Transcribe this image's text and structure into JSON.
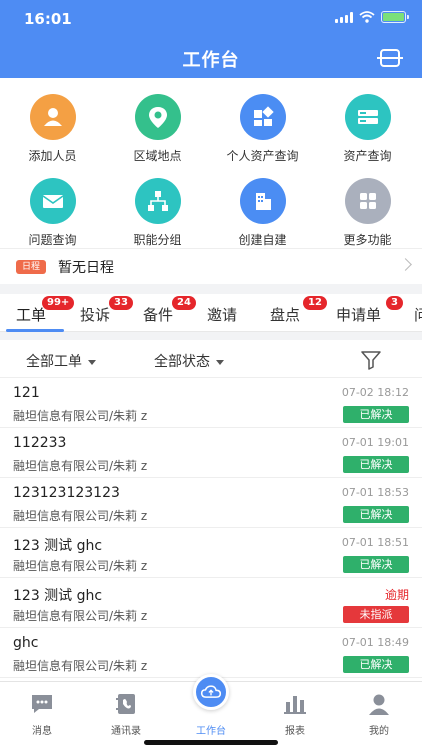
{
  "status_bar": {
    "time": "16:01"
  },
  "header": {
    "title": "工作台"
  },
  "grid": [
    {
      "label": "添加人员",
      "icon": "add-person-icon",
      "color": "#f4a044"
    },
    {
      "label": "区域地点",
      "icon": "location-pin-icon",
      "color": "#34c08c"
    },
    {
      "label": "个人资产查询",
      "icon": "personal-asset-icon",
      "color": "#4b8df3"
    },
    {
      "label": "资产查询",
      "icon": "asset-query-icon",
      "color": "#2dc4c1"
    },
    {
      "label": "问题查询",
      "icon": "problem-mail-icon",
      "color": "#2dc4c1"
    },
    {
      "label": "职能分组",
      "icon": "org-chart-icon",
      "color": "#2dc4c1"
    },
    {
      "label": "创建自建",
      "icon": "building-icon",
      "color": "#4b8df3"
    },
    {
      "label": "更多功能",
      "icon": "more-apps-icon",
      "color": "#aab0bd"
    }
  ],
  "schedule": {
    "badge": "日程",
    "text": "暂无日程"
  },
  "tabs": [
    {
      "label": "工单",
      "badge": "99+"
    },
    {
      "label": "投诉",
      "badge": "33"
    },
    {
      "label": "备件",
      "badge": "24"
    },
    {
      "label": "邀请",
      "badge": ""
    },
    {
      "label": "盘点",
      "badge": "12"
    },
    {
      "label": "申请单",
      "badge": "3"
    },
    {
      "label": "问",
      "badge": ""
    }
  ],
  "filters": {
    "type": "全部工单",
    "status": "全部状态"
  },
  "orders": [
    {
      "title": "121",
      "time": "07-02 18:12",
      "org": "融坦信息有限公司/朱莉 z",
      "status": "已解决",
      "status_color": "#2fb06b"
    },
    {
      "title": "112233",
      "time": "07-01 19:01",
      "org": "融坦信息有限公司/朱莉 z",
      "status": "已解决",
      "status_color": "#2fb06b"
    },
    {
      "title": "123123123123",
      "time": "07-01 18:53",
      "org": "融坦信息有限公司/朱莉 z",
      "status": "已解决",
      "status_color": "#2fb06b"
    },
    {
      "title": "123 测试 ghc",
      "time": "07-01 18:51",
      "org": "融坦信息有限公司/朱莉 z",
      "status": "已解决",
      "status_color": "#2fb06b"
    },
    {
      "title": "123 测试 ghc",
      "time": "逾期",
      "org": "融坦信息有限公司/朱莉 z",
      "status": "未指派",
      "status_color": "#e5383b"
    },
    {
      "title": "ghc",
      "time": "07-01 18:49",
      "org": "融坦信息有限公司/朱莉 z",
      "status": "已解决",
      "status_color": "#2fb06b"
    }
  ],
  "tabbar": [
    {
      "label": "消息",
      "icon": "message-icon"
    },
    {
      "label": "通讯录",
      "icon": "contacts-icon"
    },
    {
      "label": "工作台",
      "icon": "cloud-workbench-icon"
    },
    {
      "label": "报表",
      "icon": "report-chart-icon"
    },
    {
      "label": "我的",
      "icon": "profile-icon"
    }
  ]
}
